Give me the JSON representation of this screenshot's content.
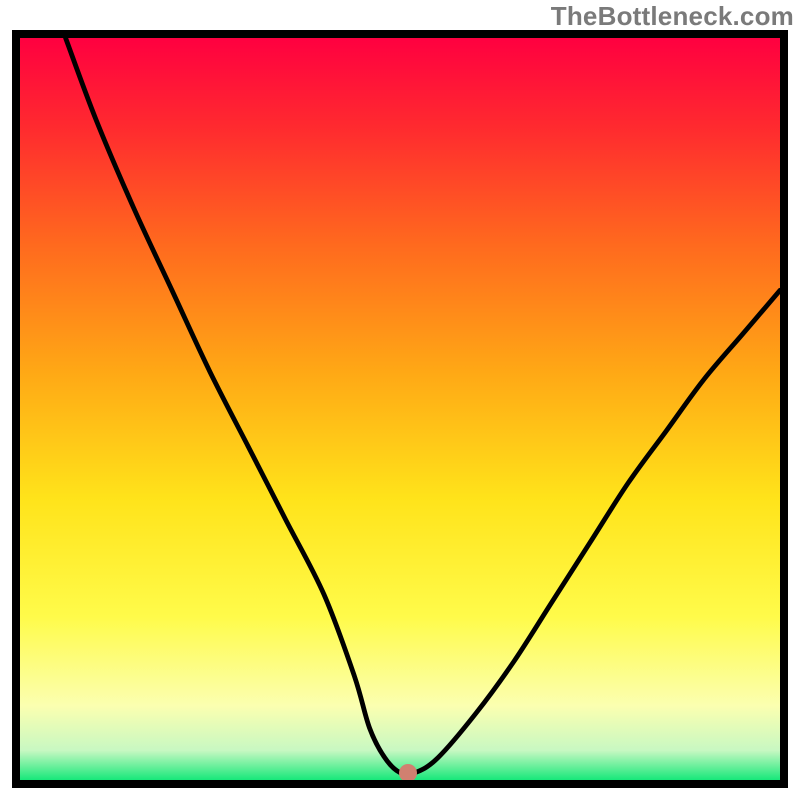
{
  "watermark": "TheBottleneck.com",
  "colors": {
    "curve": "#000000",
    "border": "#000000",
    "marker": "#d18070",
    "gradient_stops": [
      {
        "offset": "0%",
        "color": "#ff0040"
      },
      {
        "offset": "12%",
        "color": "#ff2a2f"
      },
      {
        "offset": "28%",
        "color": "#ff6a1e"
      },
      {
        "offset": "45%",
        "color": "#ffa815"
      },
      {
        "offset": "62%",
        "color": "#ffe31a"
      },
      {
        "offset": "78%",
        "color": "#fffb4a"
      },
      {
        "offset": "90%",
        "color": "#fbffb0"
      },
      {
        "offset": "96%",
        "color": "#c8f8c2"
      },
      {
        "offset": "100%",
        "color": "#17e87a"
      }
    ]
  },
  "chart_data": {
    "type": "line",
    "title": "",
    "xlabel": "",
    "ylabel": "",
    "x_range": [
      0,
      100
    ],
    "y_range": [
      0,
      100
    ],
    "x": [
      6,
      10,
      15,
      20,
      25,
      30,
      35,
      40,
      44,
      46,
      48,
      50,
      52,
      55,
      60,
      65,
      70,
      75,
      80,
      85,
      90,
      95,
      100
    ],
    "values": [
      100,
      89,
      77,
      66,
      55,
      45,
      35,
      25,
      14,
      7,
      3,
      1,
      1,
      3,
      9,
      16,
      24,
      32,
      40,
      47,
      54,
      60,
      66
    ],
    "flat_min_range_x": [
      48,
      52
    ],
    "marker": {
      "x": 51,
      "y": 1
    },
    "notes": "V-shaped bottleneck curve; y is read as percent of chart height (0 = bottom green, 100 = top red). Minimum sits around x≈48–52 near the baseline."
  }
}
